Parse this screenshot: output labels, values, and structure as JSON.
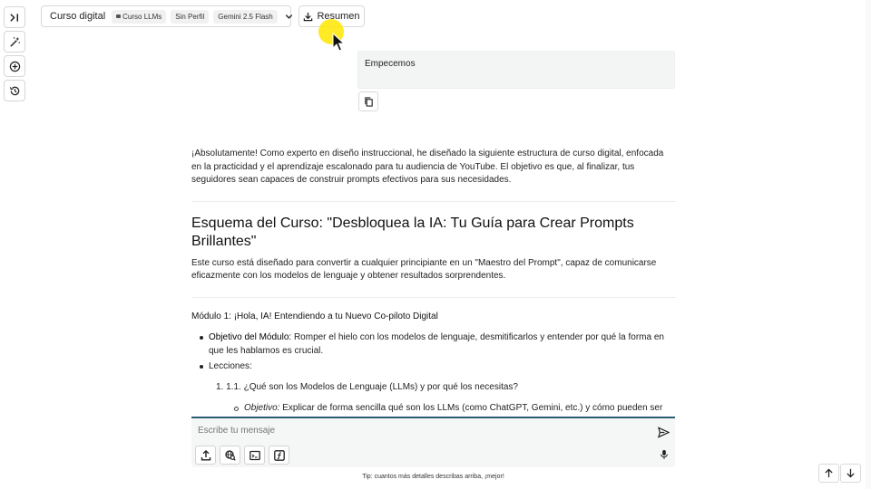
{
  "rail": {
    "items": [
      {
        "icon": "sidebar-expand-icon"
      },
      {
        "icon": "magic-wand-icon"
      },
      {
        "icon": "new-chat-icon"
      },
      {
        "icon": "history-icon"
      }
    ]
  },
  "topbar": {
    "title": "Curso digital",
    "chips": [
      "Curso LLMs",
      "Sin Perfil",
      "Gemini 2.5 Flash"
    ],
    "resumen_label": "Resumen"
  },
  "user_message": {
    "text": "Empecemos"
  },
  "answer": {
    "intro": "¡Absolutamente! Como experto en diseño instruccional, he diseñado la siguiente estructura de curso digital, enfocada en la practicidad y el aprendizaje escalonado para tu audiencia de YouTube. El objetivo es que, al finalizar, tus seguidores sean capaces de construir prompts efectivos para sus necesidades.",
    "course_title": "Esquema del Curso: \"Desbloquea la IA: Tu Guía para Crear Prompts Brillantes\"",
    "course_desc": "Este curso está diseñado para convertir a cualquier principiante en un \"Maestro del Prompt\", capaz de comunicarse eficazmente con los modelos de lenguaje y obtener resultados sorprendentes.",
    "module_title": "Módulo 1: ¡Hola, IA! Entendiendo a tu Nuevo Co-piloto Digital",
    "objective_label": "Objetivo del Módulo:",
    "objective_text": " Romper el hielo con los modelos de lenguaje, desmitificarlos y entender por qué la forma en que les hablamos es crucial.",
    "lessons_label": "Lecciones:",
    "lesson_number": "1.",
    "lesson_title": "1.1. ¿Qué son los Modelos de Lenguaje (LLMs) y por qué los necesitas?",
    "lesson_obj_label": "Objetivo:",
    "lesson_obj_text": " Explicar de forma sencilla qué son los LLMs (como ChatGPT, Gemini, etc.) y cómo pueden ser herramientas poderosas en nuestro día a día."
  },
  "composer": {
    "placeholder": "Escribe tu mensaje"
  },
  "tip": "Tip: cuantos más detalles describas arriba, ¡mejor!",
  "colors": {
    "composer_accent": "#2c5d75",
    "cursor_highlight": "#ffe600"
  }
}
